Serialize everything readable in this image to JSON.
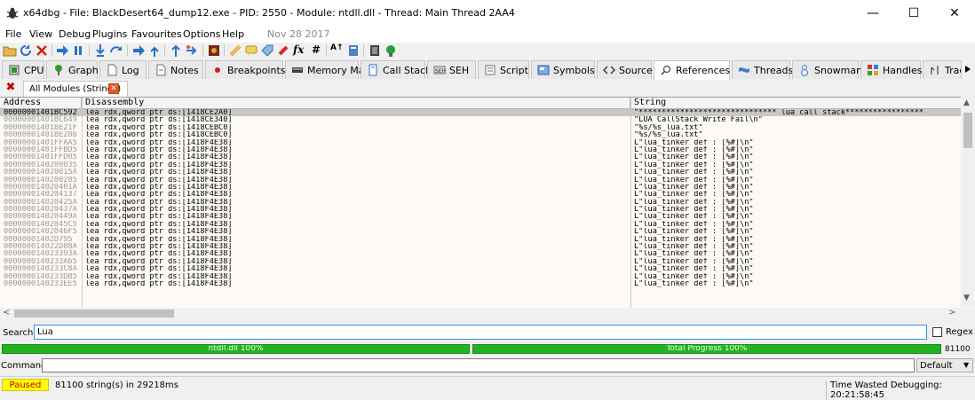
{
  "window": {
    "title": "x64dbg - File: BlackDesert64_dump12.exe - PID: 2550 - Module: ntdll.dll - Thread: Main Thread 2AA4",
    "minimize": "—",
    "maximize": "☐",
    "close": "✕"
  },
  "menu": {
    "items": [
      "File",
      "View",
      "Debug",
      "Plugins",
      "Favourites",
      "Options",
      "Help"
    ],
    "build_date": "Nov 28 2017"
  },
  "toolbar": {
    "icons": [
      "open-icon",
      "restart-icon",
      "close-icon",
      "run-icon",
      "pause-icon",
      "step-into-icon",
      "step-over-icon",
      "trace-into-icon",
      "trace-over-icon",
      "execute-till-return-icon",
      "run-to-user-code-icon",
      "scylla-icon",
      "patches-icon",
      "comments-icon",
      "labels-icon",
      "bookmarks-icon",
      "functions-icon",
      "variables-icon",
      "calculator-icon",
      "cheatsheet-icon",
      "help-icon",
      "manual-icon"
    ],
    "fx_label": "fx",
    "hash_label": "#",
    "az_label": "A↑"
  },
  "tabs": [
    {
      "label": "CPU",
      "icon": "cpu-icon"
    },
    {
      "label": "Graph",
      "icon": "graph-icon"
    },
    {
      "label": "Log",
      "icon": "log-icon"
    },
    {
      "label": "Notes",
      "icon": "notes-icon"
    },
    {
      "label": "Breakpoints",
      "icon": "breakpoint-icon"
    },
    {
      "label": "Memory Map",
      "icon": "memory-map-icon"
    },
    {
      "label": "Call Stack",
      "icon": "call-stack-icon"
    },
    {
      "label": "SEH",
      "icon": "seh-icon"
    },
    {
      "label": "Script",
      "icon": "script-icon"
    },
    {
      "label": "Symbols",
      "icon": "symbols-icon"
    },
    {
      "label": "Source",
      "icon": "source-icon"
    },
    {
      "label": "References",
      "icon": "references-icon",
      "active": true
    },
    {
      "label": "Threads",
      "icon": "threads-icon"
    },
    {
      "label": "Snowman",
      "icon": "snowman-icon"
    },
    {
      "label": "Handles",
      "icon": "handles-icon"
    },
    {
      "label": "Trace",
      "icon": "trace-icon"
    }
  ],
  "subtab": {
    "label": "All Modules (Strings)"
  },
  "table": {
    "columns": [
      "Address",
      "Disassembly",
      "String"
    ],
    "rows": [
      {
        "address": "00000001401BC592",
        "disassembly": "lea rdx,qword ptr ds:[1418CE2A0]",
        "string": "\"****************************** lua call stack*****************"
      },
      {
        "address": "00000001401BC649",
        "disassembly": "lea rdx,qword ptr ds:[1418CE340]",
        "string": "\"LUA CallStack Write Fail\\n\""
      },
      {
        "address": "00000001401BE21F",
        "disassembly": "lea rdx,qword ptr ds:[1418CEBC0]",
        "string": "\"%s/%s_lua.txt\""
      },
      {
        "address": "00000001401BE286",
        "disassembly": "lea rdx,qword ptr ds:[1418CEBC0]",
        "string": "\"%s/%s_lua.txt\""
      },
      {
        "address": "00000001401FFAA5",
        "disassembly": "lea rdx,qword ptr ds:[1418F4E38]",
        "string": "L\"lua_tinker def : [%#]\\n\""
      },
      {
        "address": "00000001401FFBD5",
        "disassembly": "lea rdx,qword ptr ds:[1418F4E38]",
        "string": "L\"lua_tinker def : [%#]\\n\""
      },
      {
        "address": "00000001401FFD05",
        "disassembly": "lea rdx,qword ptr ds:[1418F4E38]",
        "string": "L\"lua_tinker def : [%#]\\n\""
      },
      {
        "address": "0000000140200035",
        "disassembly": "lea rdx,qword ptr ds:[1418F4E38]",
        "string": "L\"lua_tinker def : [%#]\\n\""
      },
      {
        "address": "000000014020015A",
        "disassembly": "lea rdx,qword ptr ds:[1418F4E38]",
        "string": "L\"lua_tinker def : [%#]\\n\""
      },
      {
        "address": "0000000140200285",
        "disassembly": "lea rdx,qword ptr ds:[1418F4E38]",
        "string": "L\"lua_tinker def : [%#]\\n\""
      },
      {
        "address": "000000014020401A",
        "disassembly": "lea rdx,qword ptr ds:[1418F4E38]",
        "string": "L\"lua_tinker def : [%#]\\n\""
      },
      {
        "address": "0000000140204137",
        "disassembly": "lea rdx,qword ptr ds:[1418F4E38]",
        "string": "L\"lua_tinker def : [%#]\\n\""
      },
      {
        "address": "000000014020425A",
        "disassembly": "lea rdx,qword ptr ds:[1418F4E38]",
        "string": "L\"lua_tinker def : [%#]\\n\""
      },
      {
        "address": "000000014020437A",
        "disassembly": "lea rdx,qword ptr ds:[1418F4E38]",
        "string": "L\"lua_tinker def : [%#]\\n\""
      },
      {
        "address": "000000014020449A",
        "disassembly": "lea rdx,qword ptr ds:[1418F4E38]",
        "string": "L\"lua_tinker def : [%#]\\n\""
      },
      {
        "address": "00000001402045C5",
        "disassembly": "lea rdx,qword ptr ds:[1418F4E38]",
        "string": "L\"lua_tinker def : [%#]\\n\""
      },
      {
        "address": "00000001402046F5",
        "disassembly": "lea rdx,qword ptr ds:[1418F4E38]",
        "string": "L\"lua_tinker def : [%#]\\n\""
      },
      {
        "address": "00000001402D795",
        "disassembly": "lea rdx,qword ptr ds:[1418F4E38]",
        "string": "L\"lua_tinker def : [%#]\\n\""
      },
      {
        "address": "000000014022D88A",
        "disassembly": "lea rdx,qword ptr ds:[1418F4E38]",
        "string": "L\"lua_tinker def : [%#]\\n\""
      },
      {
        "address": "000000014023393A",
        "disassembly": "lea rdx,qword ptr ds:[1418F4E38]",
        "string": "L\"lua_tinker def : [%#]\\n\""
      },
      {
        "address": "0000000140233A65",
        "disassembly": "lea rdx,qword ptr ds:[1418F4E38]",
        "string": "L\"lua_tinker def : [%#]\\n\""
      },
      {
        "address": "0000000140233C8A",
        "disassembly": "lea rdx,qword ptr ds:[1418F4E38]",
        "string": "L\"lua_tinker def : [%#]\\n\""
      },
      {
        "address": "0000000140233DB5",
        "disassembly": "lea rdx,qword ptr ds:[1418F4E38]",
        "string": "L\"lua_tinker def : [%#]\\n\""
      },
      {
        "address": "0000000140233EE5",
        "disassembly": "lea rdx,qword ptr ds:[1418F4E38]",
        "string": "L\"lua_tinker def : [%#]\\n\""
      }
    ],
    "highlight_term": "lua"
  },
  "scroll": {
    "up": "▲",
    "down": "▼",
    "left": "<",
    "right": ">"
  },
  "search": {
    "label": "Search:",
    "value": "Lua",
    "regex_label": "Regex"
  },
  "progress": {
    "module_text": "ntdll.dll 100%",
    "module_value": 1.0,
    "total_text": "Total Progress 100%",
    "total_value": 1.0,
    "count": "81100"
  },
  "command": {
    "label": "Command:",
    "value": "",
    "mode": "Default"
  },
  "status": {
    "state": "Paused",
    "message": "81100 string(s) in 29218ms",
    "time_wasted": "Time Wasted Debugging: 20:21:58:45"
  },
  "colors": {
    "accent": "#3c8ddc",
    "progress": "#21b421",
    "paused_bg": "#ffff00",
    "paused_text": "#c00000",
    "highlight_underline": "#e00000"
  }
}
